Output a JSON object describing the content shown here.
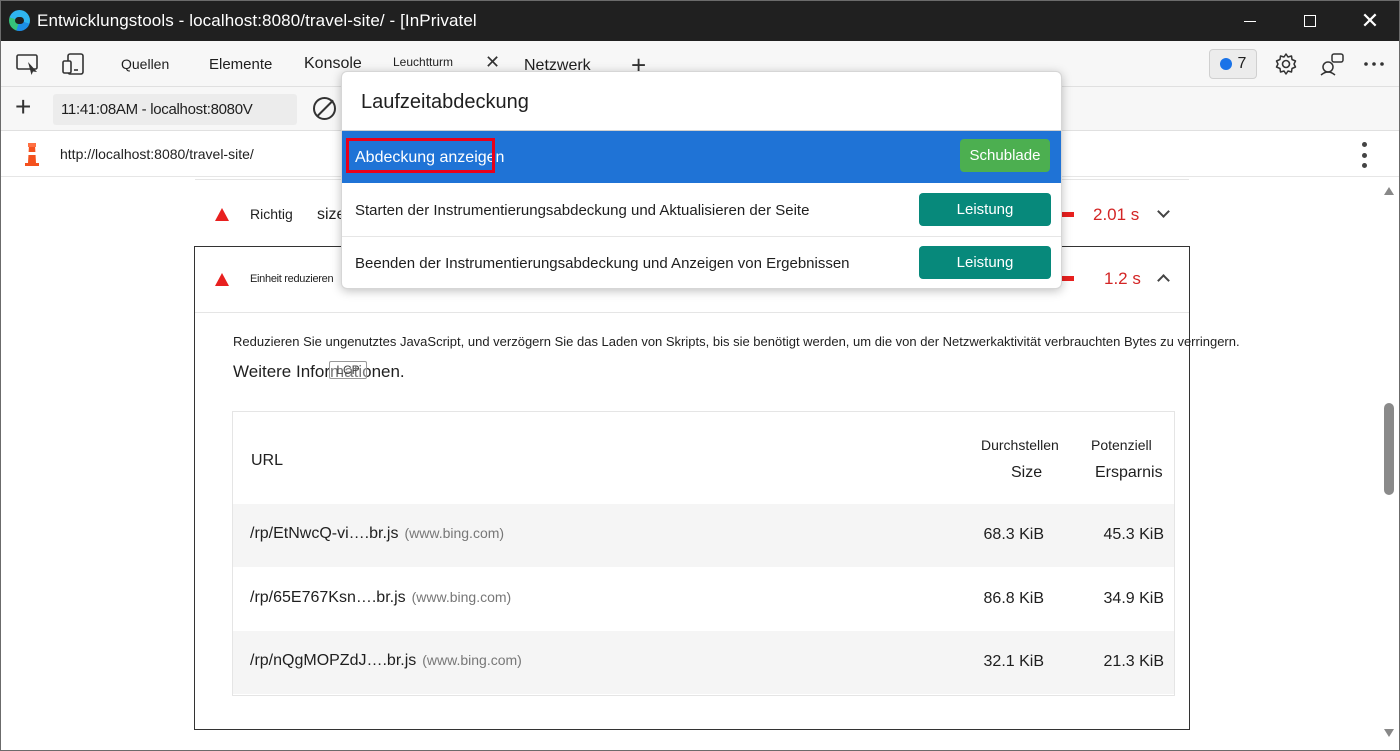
{
  "window": {
    "title": "Entwicklungstools - localhost:8080/travel-site/ - [InPrivatel"
  },
  "tabs": {
    "quellen": "Quellen",
    "elemente": "Elemente",
    "konsole": "Konsole",
    "leuchtturm": "Leuchtturm",
    "netzwerk": "Netzwerk",
    "close_glyph": "✕",
    "plus_glyph": "+"
  },
  "issues": {
    "count": "7"
  },
  "report": {
    "selector_label": "11:41:08AM - localhost:8080V"
  },
  "urlbar": {
    "url": "http://localhost:8080/travel-site/"
  },
  "audits": [
    {
      "title": "Richtig",
      "partial_text": "size",
      "savings": "2.01 s"
    },
    {
      "title": "Einheit reduzieren",
      "savings": "1.2 s"
    }
  ],
  "details": {
    "description": "Reduzieren Sie ungenutztes JavaScript, und verzögern Sie das Laden von Skripts, bis sie benötigt werden, um die von der Netzwerkaktivität verbrauchten Bytes zu verringern.",
    "learn_more": "Weitere Informationen.",
    "badge": "LCP"
  },
  "table": {
    "headers": {
      "url": "URL",
      "col1_line1": "Durchstellen",
      "col1_line2": "Size",
      "col2_line1": "Potenziell",
      "col2_line2": "Ersparnis"
    },
    "rows": [
      {
        "url": "/rp/EtNwcQ-vi….br.js",
        "domain": "(www.bing.com)",
        "transfer": "68.3 KiB",
        "savings": "45.3 KiB"
      },
      {
        "url": "/rp/65E767Ksn….br.js",
        "domain": "(www.bing.com)",
        "transfer": "86.8 KiB",
        "savings": "34.9 KiB"
      },
      {
        "url": "/rp/nQgMOPZdJ….br.js",
        "domain": "(www.bing.com)",
        "transfer": "32.1 KiB",
        "savings": "21.3 KiB"
      }
    ]
  },
  "command_menu": {
    "title": "Laufzeitabdeckung",
    "items": [
      {
        "label": "Abdeckung anzeigen",
        "tag": "Schublade"
      },
      {
        "label": "Starten der Instrumentierungsabdeckung und Aktualisieren der Seite",
        "tag": "Leistung"
      },
      {
        "label": "Beenden der Instrumentierungsabdeckung und Anzeigen von Ergebnissen",
        "tag": "Leistung"
      }
    ]
  },
  "colors": {
    "selected_item": "#1f73d6",
    "tag_drawer": "#4caf50",
    "tag_performance": "#07897b",
    "warning_red": "#e8201f",
    "highlight_red": "#e8001a"
  }
}
